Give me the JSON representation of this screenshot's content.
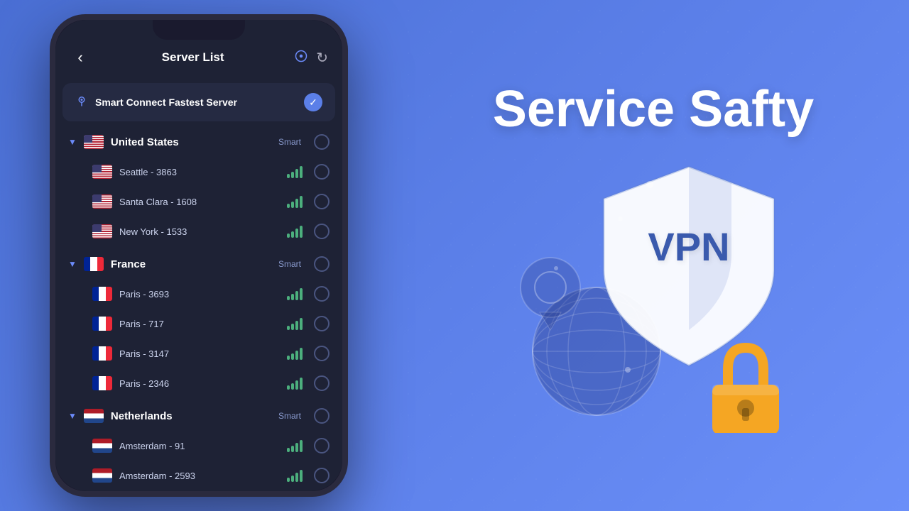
{
  "app": {
    "header": {
      "title": "Server List",
      "back_label": "‹",
      "location_icon": "📍",
      "refresh_icon": "↻"
    },
    "smart_connect": {
      "icon": "📍",
      "label": "Smart Connect Fastest Server",
      "selected": true
    },
    "countries": [
      {
        "name": "United States",
        "flag_type": "us",
        "smart_label": "Smart",
        "servers": [
          {
            "name": "Seattle - 3863",
            "signal": 4
          },
          {
            "name": "Santa Clara - 1608",
            "signal": 4
          },
          {
            "name": "New York - 1533",
            "signal": 4
          }
        ]
      },
      {
        "name": "France",
        "flag_type": "fr",
        "smart_label": "Smart",
        "servers": [
          {
            "name": "Paris - 3693",
            "signal": 4
          },
          {
            "name": "Paris - 717",
            "signal": 4
          },
          {
            "name": "Paris - 3147",
            "signal": 4
          },
          {
            "name": "Paris - 2346",
            "signal": 4
          }
        ]
      },
      {
        "name": "Netherlands",
        "flag_type": "nl",
        "smart_label": "Smart",
        "servers": [
          {
            "name": "Amsterdam - 91",
            "signal": 4
          },
          {
            "name": "Amsterdam - 2593",
            "signal": 4
          }
        ]
      }
    ]
  },
  "right": {
    "title_line1": "Service Safty",
    "vpn_text": "VPN"
  }
}
